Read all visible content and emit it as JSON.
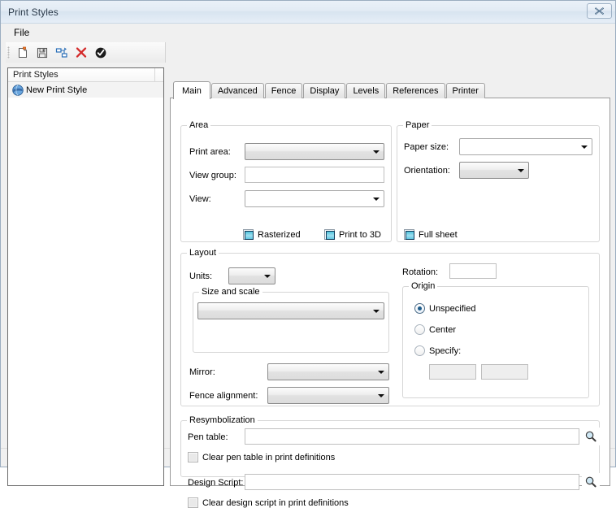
{
  "window": {
    "title": "Print Styles",
    "close_label": "✕"
  },
  "menubar": {
    "items": [
      {
        "label": "File"
      }
    ]
  },
  "toolbar": {
    "buttons": [
      {
        "name": "new-print-style",
        "icon": "new-document-icon"
      },
      {
        "name": "save-print-style",
        "icon": "save-icon"
      },
      {
        "name": "rename-print-style",
        "icon": "hierarchy-node-icon"
      },
      {
        "name": "delete-print-style",
        "icon": "delete-x-icon"
      },
      {
        "name": "apply-print-style",
        "icon": "check-circle-icon"
      }
    ]
  },
  "tree": {
    "header": "Print Styles",
    "items": [
      {
        "label": "New Print Style",
        "icon": "print-style-icon",
        "selected": true
      }
    ]
  },
  "tabs": [
    {
      "label": "Main",
      "active": true
    },
    {
      "label": "Advanced",
      "active": false
    },
    {
      "label": "Fence",
      "active": false
    },
    {
      "label": "Display",
      "active": false
    },
    {
      "label": "Levels",
      "active": false
    },
    {
      "label": "References",
      "active": false
    },
    {
      "label": "Printer",
      "active": false
    }
  ],
  "main": {
    "area": {
      "title": "Area",
      "print_area_label": "Print area:",
      "print_area_value": "",
      "view_group_label": "View group:",
      "view_group_value": "",
      "view_label": "View:",
      "view_value": "",
      "rasterized_label": "Rasterized",
      "print_to_3d_label": "Print to 3D"
    },
    "paper": {
      "title": "Paper",
      "paper_size_label": "Paper size:",
      "paper_size_value": "",
      "orientation_label": "Orientation:",
      "orientation_value": "",
      "full_sheet_label": "Full sheet"
    },
    "layout": {
      "title": "Layout",
      "units_label": "Units:",
      "units_value": "",
      "size_and_scale_title": "Size and scale",
      "size_and_scale_value": "",
      "mirror_label": "Mirror:",
      "mirror_value": "",
      "fence_alignment_label": "Fence alignment:",
      "fence_alignment_value": ""
    },
    "rotation": {
      "label": "Rotation:",
      "value": ""
    },
    "origin": {
      "title": "Origin",
      "unspecified_label": "Unspecified",
      "center_label": "Center",
      "specify_label": "Specify:",
      "x_value": "",
      "y_value": ""
    },
    "resymbolization": {
      "title": "Resymbolization",
      "pen_table_label": "Pen table:",
      "pen_table_value": "",
      "clear_pen_table_label": "Clear pen table in print definitions",
      "design_script_label": "Design Script:",
      "design_script_value": "",
      "clear_design_script_label": "Clear design script in print definitions",
      "browse_icon": "magnifier-icon"
    }
  },
  "colors": {
    "accent_teal": "#4fc3dd",
    "radio_dot": "#1f5c8a",
    "titlebar": "#e2ebf4",
    "delete_x": "#d42a2a"
  }
}
